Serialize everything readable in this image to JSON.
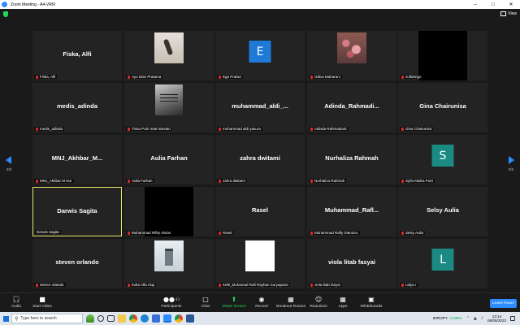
{
  "window": {
    "title": "Zoom Meeting - A4-VRIII",
    "view_label": "View"
  },
  "pagination": {
    "left": "2/2",
    "right": "2/2"
  },
  "tiles": [
    {
      "name": "Fiska, Alfi",
      "label": "Fiska, Alfi"
    },
    {
      "name": "",
      "label": "Ayu Dian Pratama"
    },
    {
      "name": "",
      "label": "Ega Pratiwi",
      "avatar": "E"
    },
    {
      "name": "",
      "label": "Odiva Maharani"
    },
    {
      "name": "",
      "label": "zulfahrigo"
    },
    {
      "name": "medis_adinda",
      "label": "medis_adinda"
    },
    {
      "name": "",
      "label": "Trisia Putri Intan Bestari"
    },
    {
      "name": "muhammad_aldi_...",
      "label": "muhammad aldi yasura"
    },
    {
      "name": "Adinda_Rahmadi...",
      "label": "Adinda Rahmadiarti"
    },
    {
      "name": "Gina Chairunisa",
      "label": "Gina Chairunisa"
    },
    {
      "name": "MNJ_Akhbar_M...",
      "label": "MNJ_Akhbar M Nur"
    },
    {
      "name": "Aulia Farhan",
      "label": "Aulia Farhan"
    },
    {
      "name": "zahra dwitami",
      "label": "zahra dwitami"
    },
    {
      "name": "Nurhaliza Rahmah",
      "label": "Nurhaliza Rahmah"
    },
    {
      "name": "",
      "label": "Syifa Malira Putri",
      "avatar": "S"
    },
    {
      "name": "Darwis Sagita",
      "label": "Darwis Sagita"
    },
    {
      "name": "",
      "label": "Muhammad Rifky Alvian"
    },
    {
      "name": "Rasel",
      "label": "Rasel"
    },
    {
      "name": "Muhammad_Rafl...",
      "label": "Muhammad Rafly Diantoro"
    },
    {
      "name": "Selsy Aulia",
      "label": "Selsy Aulia"
    },
    {
      "name": "steven orlando",
      "label": "steven orlando"
    },
    {
      "name": "",
      "label": "indra Alfa risqi"
    },
    {
      "name": "",
      "label": "Kel8_Muhamad Rafi Rayhan Suryaputra"
    },
    {
      "name": "viola litab fasyai",
      "label": "viola litab fasyai"
    },
    {
      "name": "",
      "label": "Lidya r",
      "avatar": "L"
    }
  ],
  "toolbar": {
    "audio": "Audio",
    "video": "Start Video",
    "participants": "Participants",
    "participants_count": "43",
    "chat": "Chat",
    "share": "Share Screen",
    "record": "Record",
    "breakout": "Breakout Rooms",
    "reactions": "Reactions",
    "apps": "Apps",
    "whiteboards": "Whiteboards",
    "leave": "Leave Room"
  },
  "taskbar": {
    "search_placeholder": "Type here to search",
    "stock_symbol": "IDR/JPY",
    "stock_change": "+0,95%",
    "time": "13:14",
    "date": "06/05/2023"
  },
  "colors": {
    "accent": "#2d8cff",
    "active_border": "#e8e86a",
    "muted_mic": "#e02828"
  }
}
